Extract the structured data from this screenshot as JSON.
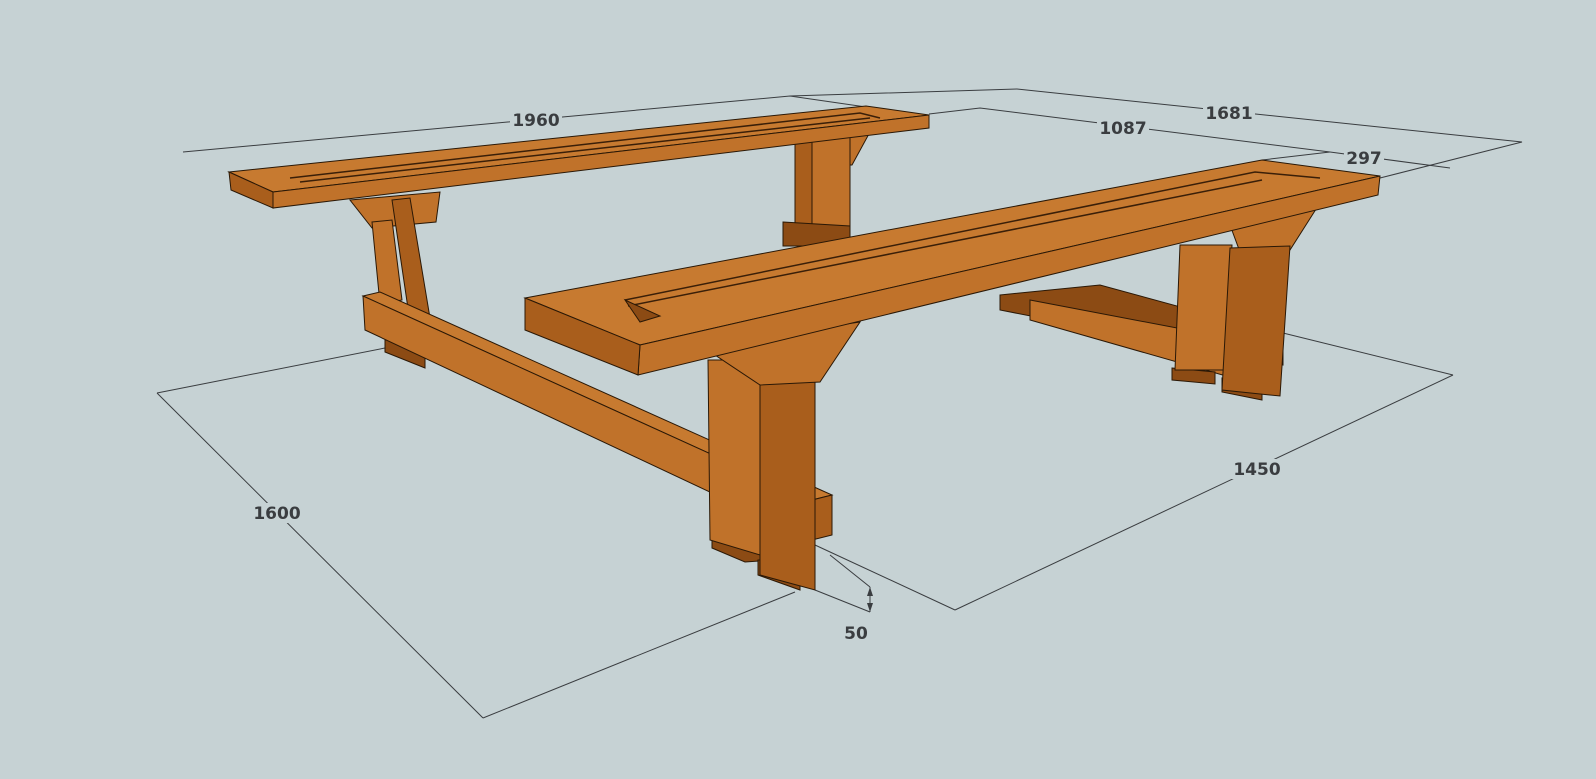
{
  "colors": {
    "background": "#c6d2d4",
    "wood_top": "#c77a30",
    "wood_front": "#c0722a",
    "wood_dark": "#8c4b14",
    "dimension": "#3a3d40"
  },
  "dimensions": {
    "back_bench_length": "1960",
    "overall_width": "1681",
    "bench_spacing": "1087",
    "seat_depth": "297",
    "front_bench_span": "1450",
    "overall_depth": "1600",
    "foot_height": "50"
  }
}
